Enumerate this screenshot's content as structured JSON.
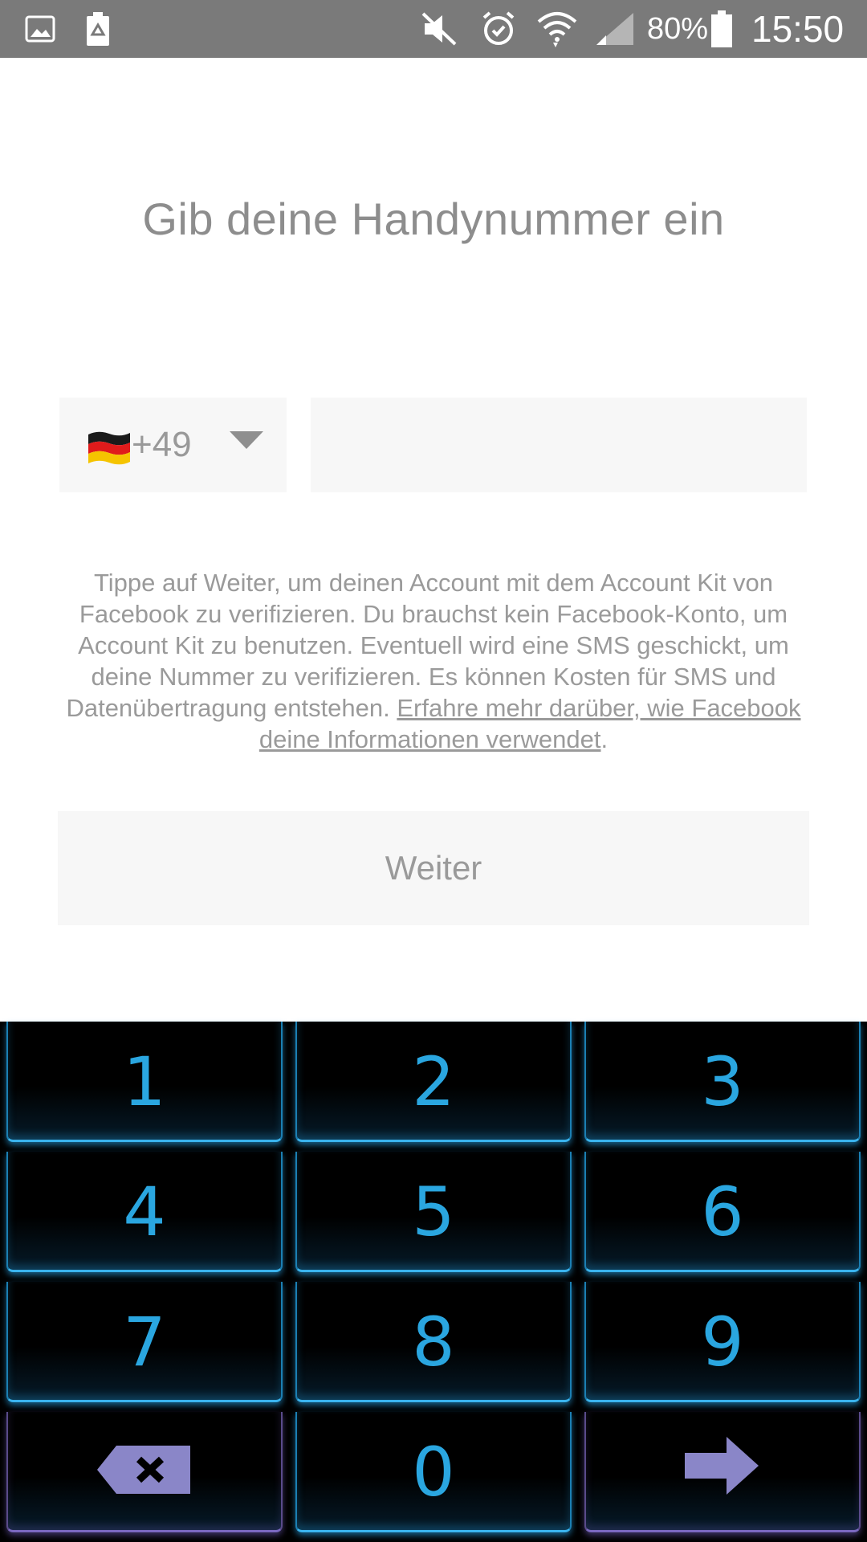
{
  "status_bar": {
    "battery_percent": "80%",
    "time": "15:50",
    "icons": [
      "gallery-icon",
      "battery-saver-icon",
      "mute-icon",
      "alarm-icon",
      "wifi-icon",
      "signal-icon",
      "battery-icon"
    ]
  },
  "main": {
    "title": "Gib deine Handynummer ein",
    "country": {
      "flag": "germany-flag-icon",
      "code": "+49"
    },
    "phone_input": {
      "value": "",
      "placeholder": ""
    },
    "disclaimer": {
      "text": "Tippe auf Weiter, um deinen Account mit dem Account Kit von Facebook zu verifizieren. Du brauchst kein Facebook-Konto, um Account Kit zu benutzen. Eventuell wird eine SMS geschickt, um deine Nummer zu verifizieren. Es können Kosten für SMS und Datenübertragung entstehen. ",
      "link": "Erfahre mehr darüber, wie Facebook deine Informationen verwendet",
      "suffix": "."
    },
    "next_button": "Weiter"
  },
  "keyboard": {
    "keys": [
      "1",
      "2",
      "3",
      "4",
      "5",
      "6",
      "7",
      "8",
      "9",
      "0"
    ],
    "special": [
      "backspace-icon",
      "next-arrow-icon"
    ],
    "colors": {
      "key_text": "#2aa6e0",
      "glow": "#3ab4ee",
      "special": "#8a86c8"
    }
  }
}
